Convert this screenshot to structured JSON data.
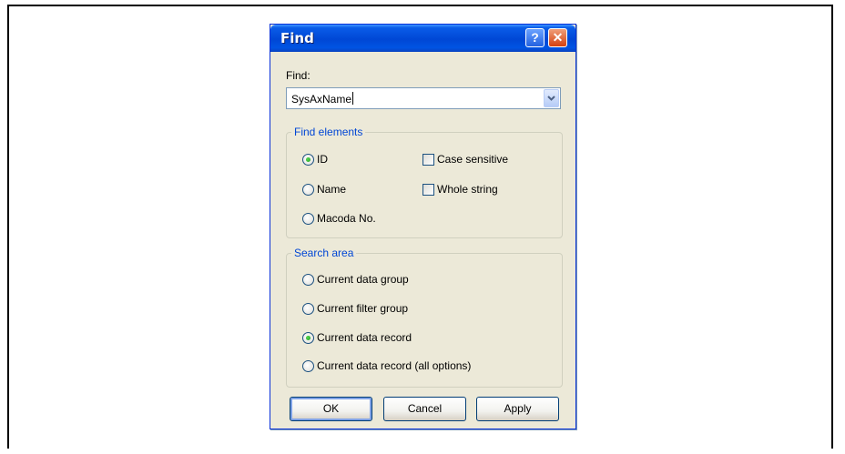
{
  "dialog": {
    "title": "Find",
    "help_glyph": "?",
    "close_glyph": "✕"
  },
  "find": {
    "label": "Find:",
    "value": "SysAxName"
  },
  "find_elements": {
    "legend": "Find elements",
    "options": [
      {
        "label": "ID",
        "checked": true
      },
      {
        "label": "Name",
        "checked": false
      },
      {
        "label": "Macoda No.",
        "checked": false
      }
    ],
    "checkboxes": [
      {
        "label": "Case sensitive",
        "checked": false
      },
      {
        "label": "Whole string",
        "checked": false
      }
    ]
  },
  "search_area": {
    "legend": "Search area",
    "options": [
      {
        "label": "Current data group",
        "checked": false
      },
      {
        "label": "Current filter group",
        "checked": false
      },
      {
        "label": "Current data record",
        "checked": true
      },
      {
        "label": "Current data record (all options)",
        "checked": false
      }
    ]
  },
  "buttons": {
    "ok": "OK",
    "cancel": "Cancel",
    "apply": "Apply"
  },
  "colors": {
    "titlebar": "#0054E3",
    "dialog_bg": "#ECE9D8",
    "legend_text": "#0046D5"
  }
}
